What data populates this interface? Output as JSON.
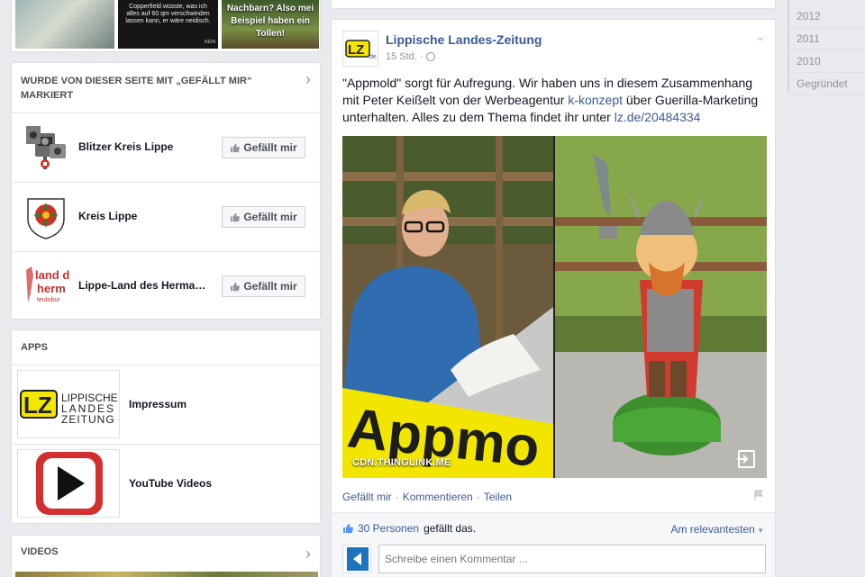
{
  "photo_strip": {
    "photo2_text": "Copperfield wüsste, was ich alles auf 60 qm verschwinden lassen kann, er wäre neidisch.",
    "photo2_corner": "NEIN",
    "photo3_text": "Nachbarn? Also mei Beispiel haben ein Tollen!"
  },
  "liked_section": {
    "title": "WURDE VON DIESER SEITE MIT „GEFÄLLT MIR“ MARKIERT",
    "pages": [
      {
        "name": "Blitzer Kreis Lippe",
        "button": "Gefällt mir",
        "icon": "speed-camera-icon"
      },
      {
        "name": "Kreis Lippe",
        "button": "Gefällt mir",
        "icon": "lippe-rose-crest-icon"
      },
      {
        "name": "Lippe-Land des Herma…",
        "button": "Gefällt mir",
        "icon": "land-des-hermann-logo"
      }
    ]
  },
  "apps_section": {
    "title": "APPS",
    "apps": [
      {
        "name": "Impressum",
        "logo_text_1": "LIPPISCHE",
        "logo_text_2": "LANDES",
        "logo_text_3": "ZEITUNG"
      },
      {
        "name": "YouTube Videos",
        "icon": "youtube-play-icon"
      }
    ]
  },
  "videos_section": {
    "title": "VIDEOS"
  },
  "post": {
    "author": "Lippische Landes-Zeitung",
    "time": "15 Std. ·",
    "text_before": "\"Appmold\" sorgt für Aufregung. Wir haben uns in diesem Zusammenhang mit Peter Keißelt von der Werbeagentur ",
    "link1": "k-konzept",
    "text_middle": " über Guerilla-Marketing unterhalten. Alles zu dem Thema findet ihr unter ",
    "link2": "lz.de/20484334",
    "image_caption": "CDN.THINGLINK.ME",
    "image_sign": "Appmo",
    "actions": {
      "like": "Gefällt mir",
      "comment": "Kommentieren",
      "share": "Teilen",
      "sep": "·"
    },
    "likes_count": "30 Personen",
    "likes_suffix": "gefällt das.",
    "sort": "Am relevantesten",
    "comment_placeholder": "Schreibe einen Kommentar ..."
  },
  "timeline": {
    "years": [
      "2012",
      "2011",
      "2010",
      "Gegründet"
    ]
  },
  "colors": {
    "link": "#3b5998",
    "page_bg": "#e9eaed",
    "muted": "#90949c"
  }
}
